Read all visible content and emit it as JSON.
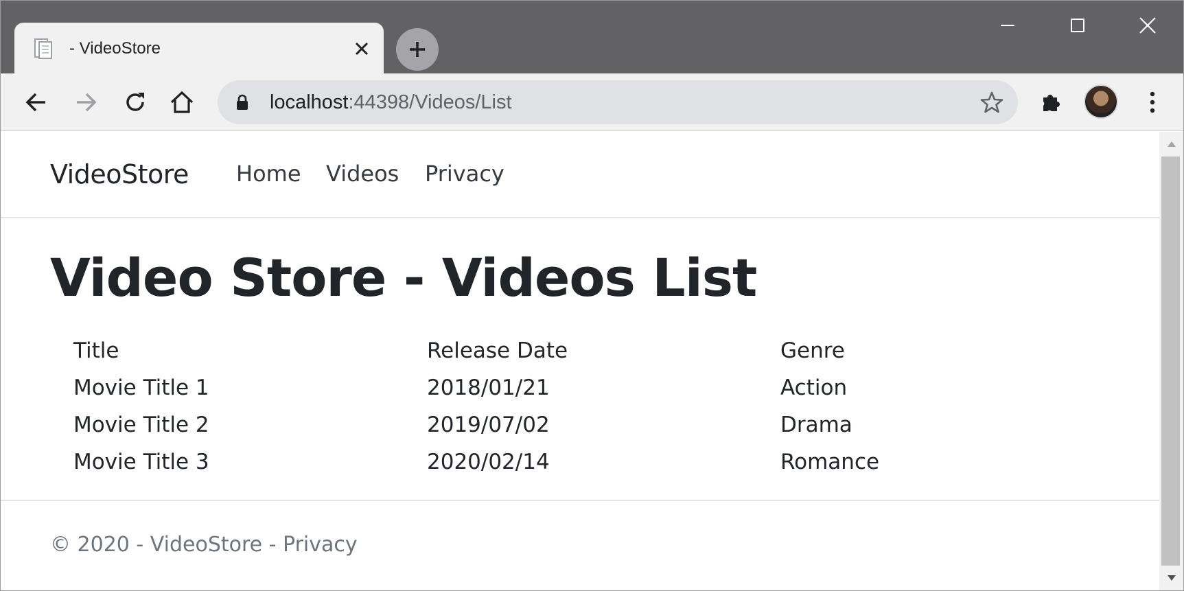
{
  "browser": {
    "tab": {
      "title": "- VideoStore",
      "favicon": "page-icon"
    },
    "address_bar": {
      "host": "localhost",
      "path": ":44398/Videos/List"
    },
    "colors": {
      "titlebar": "#626265",
      "tab_active": "#f1f1f1",
      "omnibox": "#dfe1e5"
    }
  },
  "site": {
    "brand": "VideoStore",
    "nav": [
      {
        "label": "Home"
      },
      {
        "label": "Videos"
      },
      {
        "label": "Privacy"
      }
    ]
  },
  "main": {
    "heading": "Video Store - Videos List",
    "table": {
      "headers": [
        "Title",
        "Release Date",
        "Genre"
      ],
      "rows": [
        [
          "Movie Title 1",
          "2018/01/21",
          "Action"
        ],
        [
          "Movie Title 2",
          "2019/07/02",
          "Drama"
        ],
        [
          "Movie Title 3",
          "2020/02/14",
          "Romance"
        ]
      ]
    }
  },
  "footer": {
    "copyright": "© 2020 - VideoStore - ",
    "privacy_link": "Privacy"
  }
}
